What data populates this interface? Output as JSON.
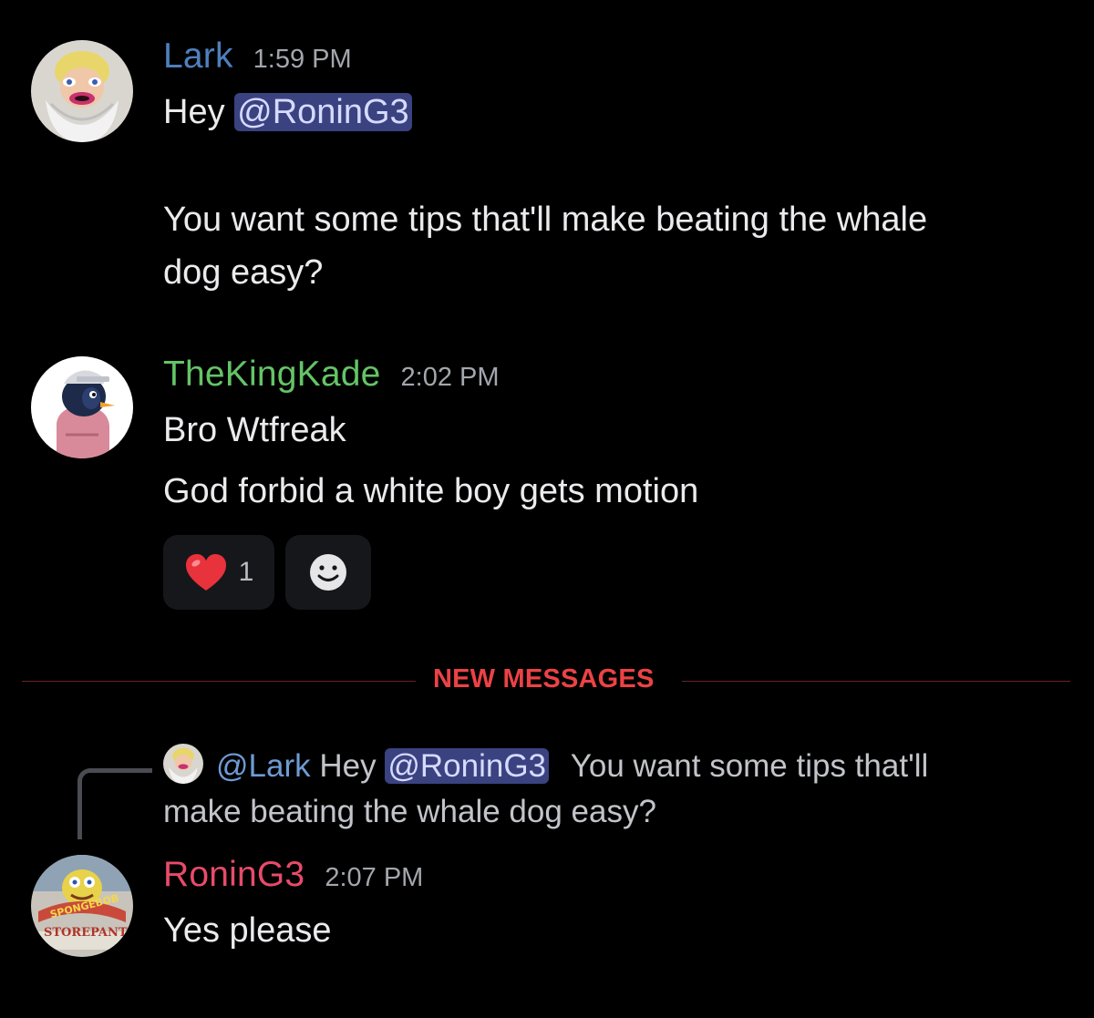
{
  "colors": {
    "background": "#000000",
    "lark_name": "#4f7fbd",
    "thekingkade_name": "#64c466",
    "ronin_name": "#e84b6a",
    "new_messages": "#ec4245",
    "mention_bg": "#3b4280"
  },
  "messages": [
    {
      "author": "Lark",
      "time": "1:59 PM",
      "avatar_icon": "old-man-avatar-icon",
      "lines": {
        "greeting": "Hey",
        "mention": "@RoninG3",
        "body_line1": "You want some tips that'll make beating the whale",
        "body_line2": "dog easy?"
      }
    },
    {
      "author": "TheKingKade",
      "time": "2:02 PM",
      "avatar_icon": "penguin-hoodie-avatar-icon",
      "lines": {
        "line1": "Bro Wtfreak",
        "line2": "God forbid a white boy gets motion"
      },
      "reactions": [
        {
          "emoji": "❤️",
          "icon": "heart-emoji-icon",
          "count": "1"
        },
        {
          "icon": "add-reaction-smiley-icon"
        }
      ]
    }
  ],
  "divider": {
    "label": "NEW MESSAGES"
  },
  "reply": {
    "reply_to_author": "@Lark",
    "reply_text_before": "Hey",
    "reply_mention": "@RoninG3",
    "reply_text_after": "You want some tips that'll",
    "reply_text_line2": "make beating the whale dog easy?",
    "author": "RoninG3",
    "time": "2:07 PM",
    "avatar_icon": "spongebob-storepants-avatar-icon",
    "avatar_text": "STOREPANTS",
    "avatar_text_top": "SPONGEBOB",
    "text": "Yes please"
  }
}
